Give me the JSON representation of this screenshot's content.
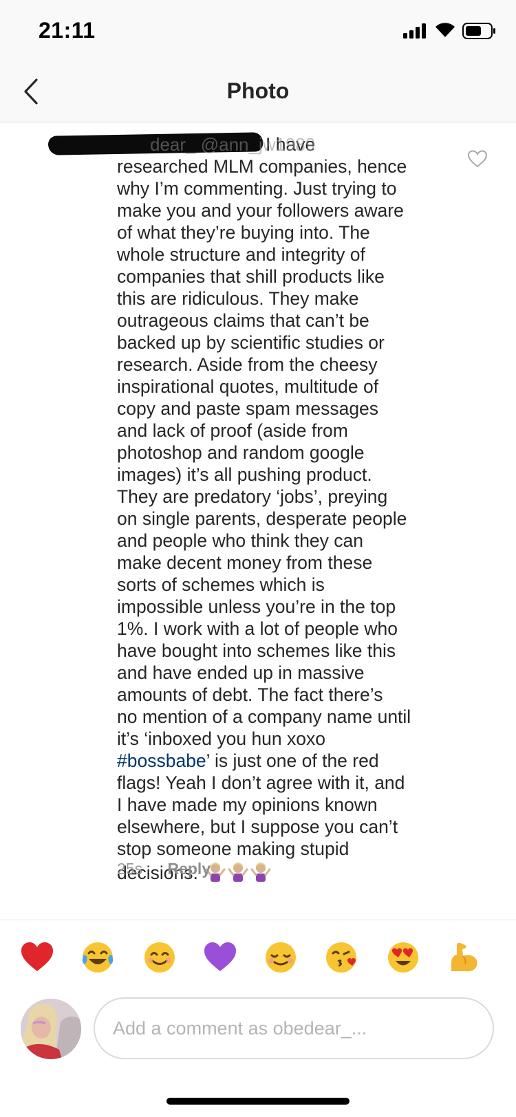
{
  "status_bar": {
    "time": "21:11"
  },
  "nav": {
    "title": "Photo"
  },
  "comment": {
    "handle_visible": "dear_ @ann_jw1989",
    "lines": [
      "I have",
      "researched MLM companies, hence",
      "why I’m commenting. Just trying to",
      "make you and your followers aware",
      "of what they’re buying into. The",
      "whole structure and integrity of",
      "companies that shill products like",
      "this are ridiculous. They make",
      "outrageous claims that can’t be",
      "backed up by scientific studies or",
      "research. Aside from the cheesy",
      "inspirational quotes, multitude of",
      "copy and paste spam messages",
      "and lack of proof (aside from",
      "photoshop and random google",
      "images) it’s all pushing product.",
      "They are predatory ‘jobs’, preying",
      "on single parents, desperate people",
      "and people who think they can",
      "make decent money from these",
      "sorts of schemes which is",
      "impossible unless you’re in the top",
      "1%. I work with a lot of people who",
      "have bought into schemes like this",
      "and have ended up in massive",
      "amounts of debt. The fact there’s",
      "no mention of a company name until",
      "it’s ‘inboxed you hun xoxo"
    ],
    "hashtag": "#bossbabe",
    "after_hashtag": "’ is just one of the red",
    "lines_end": [
      "flags! Yeah I don’t agree with it, and",
      "I have made my opinions known",
      "elsewhere, but I suppose you can’t",
      "stop someone making stupid"
    ],
    "last_line": "decisions.",
    "timestamp": "25s",
    "reply_label": "Reply"
  },
  "reactions": [
    "heart-emoji",
    "tears-of-joy-emoji",
    "smiling-emoji",
    "purple-heart-emoji",
    "relaxed-emoji",
    "kissing-heart-emoji",
    "heart-eyes-emoji",
    "flexed-biceps-emoji"
  ],
  "composer": {
    "placeholder": "Add a comment as obedear_..."
  },
  "colors": {
    "hashtag": "#003569",
    "secondary_text": "#999999",
    "primary_text": "#262626"
  }
}
